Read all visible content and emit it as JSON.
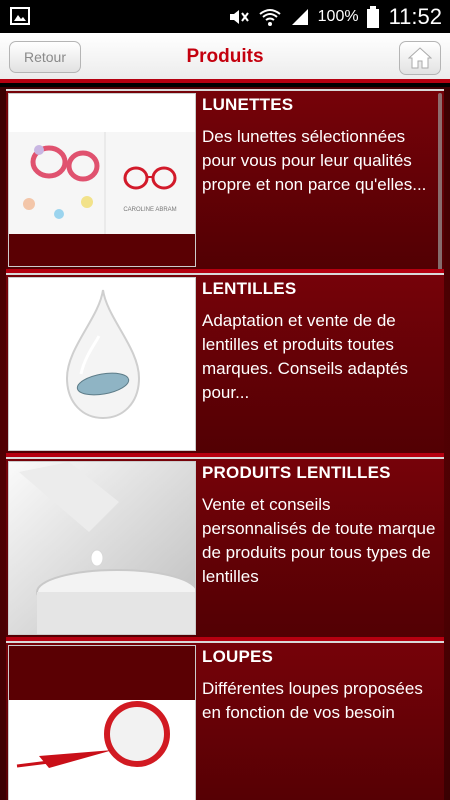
{
  "status": {
    "battery_pct": "100%",
    "time": "11:52"
  },
  "header": {
    "back_label": "Retour",
    "title": "Produits"
  },
  "products": [
    {
      "title": "LUNETTES",
      "desc": "Des lunettes sélectionnées pour vous pour leur qualités propre et non parce qu'elles...",
      "thumb_caption": "CAROLINE ABRAM"
    },
    {
      "title": "LENTILLES",
      "desc": "Adaptation et vente de de lentilles et produits toutes marques. Conseils adaptés pour..."
    },
    {
      "title": "PRODUITS LENTILLES",
      "desc": "Vente et conseils personnalisés de toute marque de produits pour tous types de lentilles"
    },
    {
      "title": "LOUPES",
      "desc": "Différentes loupes proposées en fonction de vos besoin"
    }
  ]
}
